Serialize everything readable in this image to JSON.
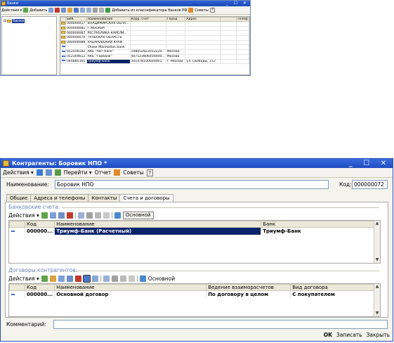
{
  "banks_window": {
    "title": "Банки",
    "toolbar": {
      "actions_label": "Действия ▾",
      "add_label": "Добавить",
      "classifier_label": "Добавить из классификатора банков РФ",
      "tips_label": "Советы"
    },
    "tree": {
      "root_label": "Банки"
    },
    "columns": [
      "БИК",
      "Наименование",
      "Корр. счет",
      "Город",
      "Адрес",
      "Телеф"
    ],
    "rows": [
      {
        "icon": "folder",
        "bik": "000000017",
        "name": "ВЛАДИМИРСКАЯ ОБЛА...",
        "corr": "",
        "city": "",
        "address": ""
      },
      {
        "icon": "folder",
        "bik": "000000081",
        "name": "Г.МОСКВА",
        "corr": "",
        "city": "",
        "address": ""
      },
      {
        "icon": "folder",
        "bik": "000000087",
        "name": "РЕСПУБЛИКА КАРЕЛИ...",
        "corr": "",
        "city": "",
        "address": ""
      },
      {
        "icon": "folder",
        "bik": "000000070",
        "name": "ТУЛЬСКАЯ ОБЛАСТЬ",
        "corr": "",
        "city": "",
        "address": ""
      },
      {
        "icon": "folder",
        "bik": "000000088",
        "name": "ХАБАРОВСКИЙ КРАЙ",
        "corr": "",
        "city": "",
        "address": ""
      },
      {
        "icon": "item",
        "bik": "",
        "name": "Chase Manhattan bank",
        "corr": "",
        "city": "",
        "address": ""
      },
      {
        "icon": "item",
        "bik": "052500182",
        "name": "АКБ \"АВТ-банк\"",
        "corr": "108052823012220...",
        "city": "Москва",
        "address": ""
      },
      {
        "icon": "item",
        "bik": "052304612",
        "name": "АКБ \"Гарбанк\"",
        "corr": "407123806456600...",
        "city": "Москва",
        "address": ""
      },
      {
        "icon": "item",
        "bik": "044885365",
        "name": "Триумф-Банк",
        "corr": "301078100600001...",
        "city": "г. Москва",
        "address": "ул. Свободы, 112",
        "selected": true
      }
    ]
  },
  "contractor_window": {
    "title": "Контрагенты: Боровик НПО *",
    "toolbar": {
      "actions_label": "Действия ▾",
      "goto_label": "Перейти ▾",
      "report_label": "Отчет",
      "tips_label": "Советы",
      "help_label": "?"
    },
    "name_label": "Наименование:",
    "name_value": "Боровик НПО",
    "code_label": "Код:",
    "code_value": "000000072",
    "tabs": [
      "Общие",
      "Адреса и телефоны",
      "Контакты",
      "Счета и договоры"
    ],
    "active_tab": 3,
    "bank_accounts": {
      "section_label": "Банковские счета:",
      "actions_label": "Действия ▾",
      "main_button": "Основной",
      "columns": [
        "Код",
        "Наименование",
        "Банк"
      ],
      "rows": [
        {
          "code": "000000...",
          "name": "Триумф-Банк (Расчетный)",
          "bank": "Триумф-Банк",
          "selected": true
        }
      ]
    },
    "contracts": {
      "section_label": "Договоры контрагентов:",
      "actions_label": "Действия ▾",
      "main_button": "Основной",
      "columns": [
        "Код",
        "Наименование",
        "Ведение взаиморасчетов",
        "Вид договора"
      ],
      "rows": [
        {
          "code": "000000...",
          "name": "Основной договор",
          "settlement": "По договору в целом",
          "kind": "С покупателем"
        }
      ]
    },
    "comment_label": "Комментарий:",
    "comment_value": "",
    "buttons": {
      "ok": "OK",
      "save": "Записать",
      "close": "Закрыть"
    }
  }
}
